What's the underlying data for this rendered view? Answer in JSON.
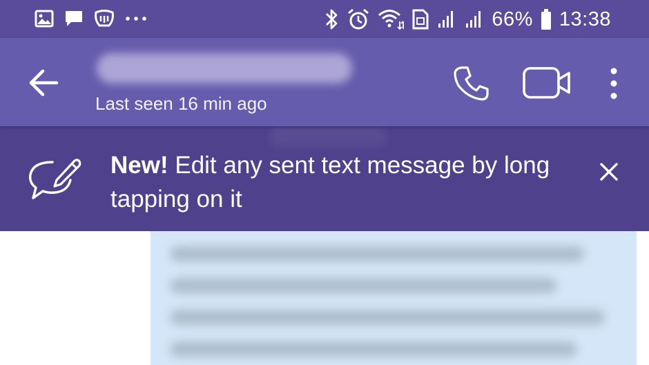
{
  "status_bar": {
    "battery": "66%",
    "time": "13:38",
    "left_icons": [
      "image-icon",
      "message-icon",
      "viber-out-icon",
      "more-dots-icon"
    ],
    "right_icons": [
      "bluetooth-icon",
      "alarm-icon",
      "wifi-icon",
      "sim-icon",
      "signal-icon",
      "signal-icon",
      "battery-icon"
    ]
  },
  "app_bar": {
    "last_seen": "Last seen 16 min ago",
    "icons": [
      "back-arrow-icon",
      "phone-icon",
      "video-camera-icon",
      "more-vertical-icon"
    ]
  },
  "banner": {
    "highlight": "New!",
    "message": " Edit any sent text message by long tapping on it",
    "icons": [
      "edit-message-icon",
      "close-icon"
    ]
  },
  "colors": {
    "status_bar": "#5b4b9b",
    "app_bar": "#665cad",
    "banner": "#4f418c",
    "bubble": "#d4e6f8"
  }
}
